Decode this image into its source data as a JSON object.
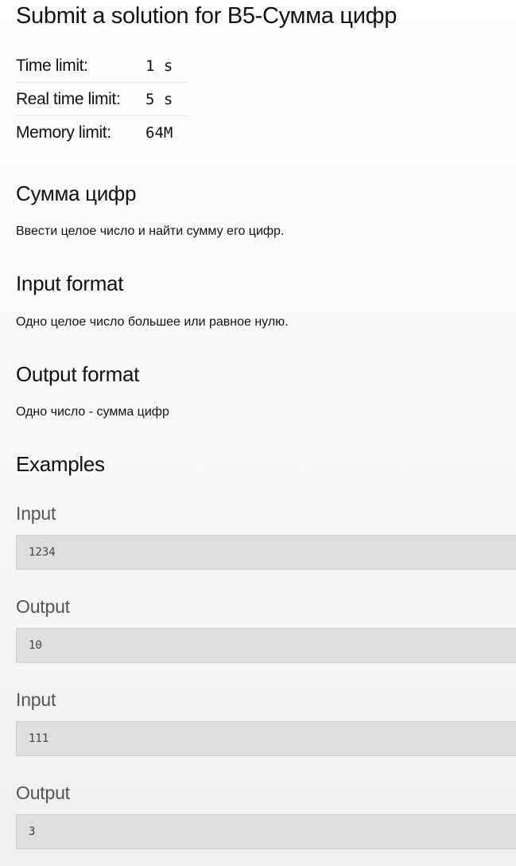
{
  "page_title": "Submit a solution for B5-Сумма цифр",
  "limits": [
    {
      "label": "Time limit:",
      "value": "1 s"
    },
    {
      "label": "Real time limit:",
      "value": "5 s"
    },
    {
      "label": "Memory limit:",
      "value": "64M"
    }
  ],
  "statement": {
    "title": "Сумма цифр",
    "text": "Ввести целое число и найти сумму его цифр."
  },
  "input_format": {
    "title": "Input format",
    "text": "Одно целое число большее или равное нулю."
  },
  "output_format": {
    "title": "Output format",
    "text": "Одно число - сумма цифр"
  },
  "examples": {
    "title": "Examples",
    "items": [
      {
        "label": "Input",
        "value": "1234"
      },
      {
        "label": "Output",
        "value": "10"
      },
      {
        "label": "Input",
        "value": "111"
      },
      {
        "label": "Output",
        "value": "3"
      }
    ]
  }
}
